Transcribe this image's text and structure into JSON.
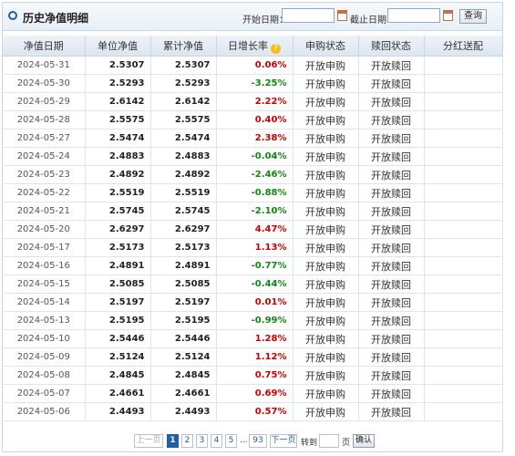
{
  "header": {
    "title": "历史净值明细",
    "start_label": "开始日期：",
    "end_label": "截止日期：",
    "query_label": "查询"
  },
  "colors": {
    "up": "#cc0000",
    "down": "#118811",
    "accent": "#1f5fa5"
  },
  "columns": [
    "净值日期",
    "单位净值",
    "累计净值",
    "日增长率",
    "申购状态",
    "赎回状态",
    "分红送配"
  ],
  "rows": [
    {
      "date": "2024-05-31",
      "unit": "2.5307",
      "acc": "2.5307",
      "rate": "0.06%",
      "dir": "up",
      "buy": "开放申购",
      "redeem": "开放赎回",
      "div": ""
    },
    {
      "date": "2024-05-30",
      "unit": "2.5293",
      "acc": "2.5293",
      "rate": "-3.25%",
      "dir": "down",
      "buy": "开放申购",
      "redeem": "开放赎回",
      "div": ""
    },
    {
      "date": "2024-05-29",
      "unit": "2.6142",
      "acc": "2.6142",
      "rate": "2.22%",
      "dir": "up",
      "buy": "开放申购",
      "redeem": "开放赎回",
      "div": ""
    },
    {
      "date": "2024-05-28",
      "unit": "2.5575",
      "acc": "2.5575",
      "rate": "0.40%",
      "dir": "up",
      "buy": "开放申购",
      "redeem": "开放赎回",
      "div": ""
    },
    {
      "date": "2024-05-27",
      "unit": "2.5474",
      "acc": "2.5474",
      "rate": "2.38%",
      "dir": "up",
      "buy": "开放申购",
      "redeem": "开放赎回",
      "div": ""
    },
    {
      "date": "2024-05-24",
      "unit": "2.4883",
      "acc": "2.4883",
      "rate": "-0.04%",
      "dir": "down",
      "buy": "开放申购",
      "redeem": "开放赎回",
      "div": ""
    },
    {
      "date": "2024-05-23",
      "unit": "2.4892",
      "acc": "2.4892",
      "rate": "-2.46%",
      "dir": "down",
      "buy": "开放申购",
      "redeem": "开放赎回",
      "div": ""
    },
    {
      "date": "2024-05-22",
      "unit": "2.5519",
      "acc": "2.5519",
      "rate": "-0.88%",
      "dir": "down",
      "buy": "开放申购",
      "redeem": "开放赎回",
      "div": ""
    },
    {
      "date": "2024-05-21",
      "unit": "2.5745",
      "acc": "2.5745",
      "rate": "-2.10%",
      "dir": "down",
      "buy": "开放申购",
      "redeem": "开放赎回",
      "div": ""
    },
    {
      "date": "2024-05-20",
      "unit": "2.6297",
      "acc": "2.6297",
      "rate": "4.47%",
      "dir": "up",
      "buy": "开放申购",
      "redeem": "开放赎回",
      "div": ""
    },
    {
      "date": "2024-05-17",
      "unit": "2.5173",
      "acc": "2.5173",
      "rate": "1.13%",
      "dir": "up",
      "buy": "开放申购",
      "redeem": "开放赎回",
      "div": ""
    },
    {
      "date": "2024-05-16",
      "unit": "2.4891",
      "acc": "2.4891",
      "rate": "-0.77%",
      "dir": "down",
      "buy": "开放申购",
      "redeem": "开放赎回",
      "div": ""
    },
    {
      "date": "2024-05-15",
      "unit": "2.5085",
      "acc": "2.5085",
      "rate": "-0.44%",
      "dir": "down",
      "buy": "开放申购",
      "redeem": "开放赎回",
      "div": ""
    },
    {
      "date": "2024-05-14",
      "unit": "2.5197",
      "acc": "2.5197",
      "rate": "0.01%",
      "dir": "up",
      "buy": "开放申购",
      "redeem": "开放赎回",
      "div": ""
    },
    {
      "date": "2024-05-13",
      "unit": "2.5195",
      "acc": "2.5195",
      "rate": "-0.99%",
      "dir": "down",
      "buy": "开放申购",
      "redeem": "开放赎回",
      "div": ""
    },
    {
      "date": "2024-05-10",
      "unit": "2.5446",
      "acc": "2.5446",
      "rate": "1.28%",
      "dir": "up",
      "buy": "开放申购",
      "redeem": "开放赎回",
      "div": ""
    },
    {
      "date": "2024-05-09",
      "unit": "2.5124",
      "acc": "2.5124",
      "rate": "1.12%",
      "dir": "up",
      "buy": "开放申购",
      "redeem": "开放赎回",
      "div": ""
    },
    {
      "date": "2024-05-08",
      "unit": "2.4845",
      "acc": "2.4845",
      "rate": "0.75%",
      "dir": "up",
      "buy": "开放申购",
      "redeem": "开放赎回",
      "div": ""
    },
    {
      "date": "2024-05-07",
      "unit": "2.4661",
      "acc": "2.4661",
      "rate": "0.69%",
      "dir": "up",
      "buy": "开放申购",
      "redeem": "开放赎回",
      "div": ""
    },
    {
      "date": "2024-05-06",
      "unit": "2.4493",
      "acc": "2.4493",
      "rate": "0.57%",
      "dir": "up",
      "buy": "开放申购",
      "redeem": "开放赎回",
      "div": ""
    }
  ],
  "pager": {
    "prev": "上一页",
    "pages": [
      "1",
      "2",
      "3",
      "4",
      "5"
    ],
    "ellipsis": "...",
    "last": "93",
    "next": "下一页",
    "goto": "转到",
    "page_unit": "页",
    "confirm": "确认",
    "current_page": 1
  }
}
